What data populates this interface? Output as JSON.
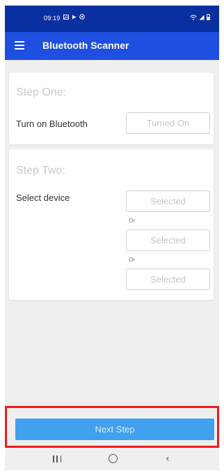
{
  "status_bar": {
    "time": "09:19",
    "left_icons": [
      "image-icon",
      "play-icon",
      "vpn-icon"
    ],
    "right_icons": [
      "wifi-icon",
      "signal-icon",
      "battery-icon"
    ]
  },
  "app_bar": {
    "title": "Bluetooth Scanner",
    "menu_icon": "hamburger-menu-icon"
  },
  "step_one": {
    "title": "Step One:",
    "label": "Turn on Bluetooth",
    "button": "Turned On"
  },
  "step_two": {
    "title": "Step Two:",
    "label": "Select device",
    "options": [
      "Selected",
      "Selected",
      "Selected"
    ],
    "or_text": "Or"
  },
  "footer": {
    "next_label": "Next Step"
  },
  "navigation": {
    "icons": [
      "recents-icon",
      "home-icon",
      "back-icon"
    ],
    "back_glyph": "‹"
  },
  "colors": {
    "status_bar": "#0a2fa0",
    "app_bar": "#1e4fe0",
    "primary_button": "#41a0f0",
    "highlight_border": "#ee1c1c",
    "background": "#efefef"
  }
}
